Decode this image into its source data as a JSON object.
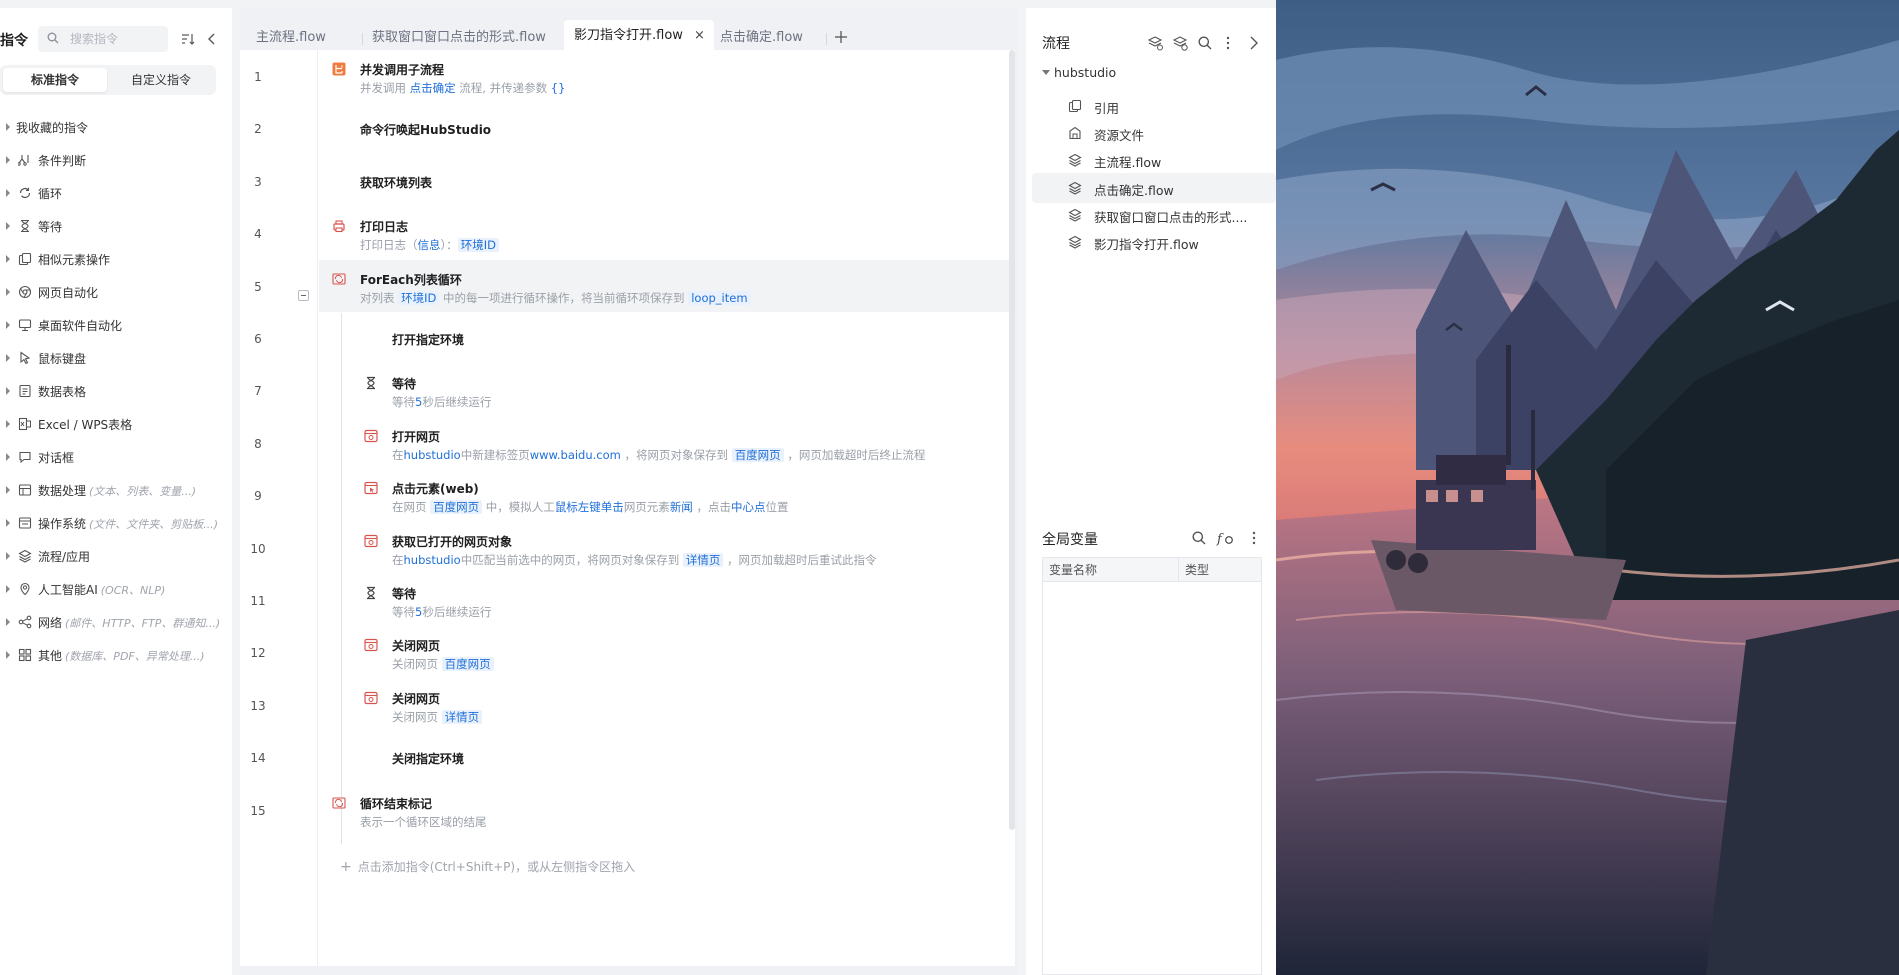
{
  "left_panel": {
    "title": "指令",
    "search_placeholder": "搜索指令",
    "segments": [
      "标准指令",
      "自定义指令"
    ],
    "categories": [
      {
        "label": "我收藏的指令",
        "sub": "",
        "icon": "none"
      },
      {
        "label": "条件判断",
        "sub": "",
        "icon": "branch-icon"
      },
      {
        "label": "循环",
        "sub": "",
        "icon": "loop-icon"
      },
      {
        "label": "等待",
        "sub": "",
        "icon": "hourglass-icon"
      },
      {
        "label": "相似元素操作",
        "sub": "",
        "icon": "copy-icon"
      },
      {
        "label": "网页自动化",
        "sub": "",
        "icon": "browser-icon"
      },
      {
        "label": "桌面软件自动化",
        "sub": "",
        "icon": "monitor-icon"
      },
      {
        "label": "鼠标键盘",
        "sub": "",
        "icon": "cursor-icon"
      },
      {
        "label": "数据表格",
        "sub": "",
        "icon": "sheet-icon"
      },
      {
        "label": "Excel / WPS表格",
        "sub": "",
        "icon": "excel-icon"
      },
      {
        "label": "对话框",
        "sub": "",
        "icon": "dialog-icon"
      },
      {
        "label": "数据处理",
        "sub": "(文本、列表、变量...)",
        "icon": "data-icon"
      },
      {
        "label": "操作系统",
        "sub": "(文件、文件夹、剪贴板...)",
        "icon": "os-icon"
      },
      {
        "label": "流程/应用",
        "sub": "",
        "icon": "layers-icon"
      },
      {
        "label": "人工智能AI",
        "sub": "(OCR、NLP)",
        "icon": "ai-icon"
      },
      {
        "label": "网络",
        "sub": "(邮件、HTTP、FTP、群通知...)",
        "icon": "network-icon"
      },
      {
        "label": "其他",
        "sub": "(数据库、PDF、异常处理...)",
        "icon": "grid-icon"
      }
    ]
  },
  "tabs": [
    {
      "label": "主流程.flow",
      "active": false
    },
    {
      "label": "获取窗口窗口点击的形式.flow",
      "active": false
    },
    {
      "label": "影刀指令打开.flow",
      "active": true
    },
    {
      "label": "点击确定.flow",
      "active": false
    }
  ],
  "tab_close": "×",
  "steps": [
    {
      "no": "1",
      "title": "并发调用子流程",
      "desc": [
        [
          "t",
          "并发调用 "
        ],
        [
          "b",
          "点击确定"
        ],
        [
          "t",
          " 流程, 并传递参数 "
        ],
        [
          "b",
          "{}"
        ]
      ]
    },
    {
      "no": "2",
      "title": "命令行唤起HubStudio",
      "desc": []
    },
    {
      "no": "3",
      "title": "获取环境列表",
      "desc": []
    },
    {
      "no": "4",
      "title": "打印日志",
      "desc": [
        [
          "t",
          "打印日志（"
        ],
        [
          "b",
          "信息"
        ],
        [
          "t",
          "）："
        ],
        [
          "bb",
          "环境ID"
        ]
      ]
    },
    {
      "no": "5",
      "title": "ForEach列表循环",
      "desc": [
        [
          "t",
          "对列表 "
        ],
        [
          "bb",
          "环境ID"
        ],
        [
          "t",
          " 中的每一项进行循环操作，将当前循环项保存到 "
        ],
        [
          "bb",
          "loop_item"
        ]
      ]
    },
    {
      "no": "6",
      "title": "打开指定环境",
      "desc": []
    },
    {
      "no": "7",
      "title": "等待",
      "desc": [
        [
          "t",
          "等待"
        ],
        [
          "b",
          "5"
        ],
        [
          "t",
          "秒后继续运行"
        ]
      ]
    },
    {
      "no": "8",
      "title": "打开网页",
      "desc": [
        [
          "t",
          "在"
        ],
        [
          "b",
          "hubstudio"
        ],
        [
          "t",
          "中新建标签页"
        ],
        [
          "b",
          "www.baidu.com"
        ],
        [
          "t",
          " ，将网页对象保存到 "
        ],
        [
          "bb",
          "百度网页"
        ],
        [
          "t",
          " ，网页加载超时后终止流程"
        ]
      ]
    },
    {
      "no": "9",
      "title": "点击元素(web)",
      "desc": [
        [
          "t",
          "在网页 "
        ],
        [
          "bb",
          "百度网页"
        ],
        [
          "t",
          " 中，模拟人工"
        ],
        [
          "b",
          "鼠标左键单击"
        ],
        [
          "t",
          "网页元素"
        ],
        [
          "b",
          "新闻"
        ],
        [
          "t",
          " ，点击"
        ],
        [
          "b",
          "中心点"
        ],
        [
          "t",
          "位置"
        ]
      ]
    },
    {
      "no": "10",
      "title": "获取已打开的网页对象",
      "desc": [
        [
          "t",
          "在"
        ],
        [
          "b",
          "hubstudio"
        ],
        [
          "t",
          "中匹配当前选中的网页，将网页对象保存到 "
        ],
        [
          "bb",
          "详情页"
        ],
        [
          "t",
          " ，网页加载超时后重试此指令"
        ]
      ]
    },
    {
      "no": "11",
      "title": "等待",
      "desc": [
        [
          "t",
          "等待"
        ],
        [
          "b",
          "5"
        ],
        [
          "t",
          "秒后继续运行"
        ]
      ]
    },
    {
      "no": "12",
      "title": "关闭网页",
      "desc": [
        [
          "t",
          "关闭网页 "
        ],
        [
          "bb",
          "百度网页"
        ]
      ]
    },
    {
      "no": "13",
      "title": "关闭网页",
      "desc": [
        [
          "t",
          "关闭网页 "
        ],
        [
          "bb",
          "详情页"
        ]
      ]
    },
    {
      "no": "14",
      "title": "关闭指定环境",
      "desc": []
    },
    {
      "no": "15",
      "title": "循环结束标记",
      "desc": [
        [
          "t",
          "表示一个循环区域的结尾"
        ]
      ]
    }
  ],
  "add_hint": "点击添加指令(Ctrl+Shift+P)，或从左侧指令区拖入",
  "right_panel": {
    "flow_title": "流程",
    "tree_root": "hubstudio",
    "tree_items": [
      {
        "label": "引用",
        "icon": "reference-icon"
      },
      {
        "label": "资源文件",
        "icon": "resource-icon"
      },
      {
        "label": "主流程.flow",
        "icon": "flow-icon"
      },
      {
        "label": "点击确定.flow",
        "icon": "flow-icon"
      },
      {
        "label": "获取窗口窗口点击的形式....",
        "icon": "flow-icon"
      },
      {
        "label": "影刀指令打开.flow",
        "icon": "flow-icon"
      }
    ],
    "vars_title": "全局变量",
    "vars_columns": [
      "变量名称",
      "类型"
    ]
  }
}
